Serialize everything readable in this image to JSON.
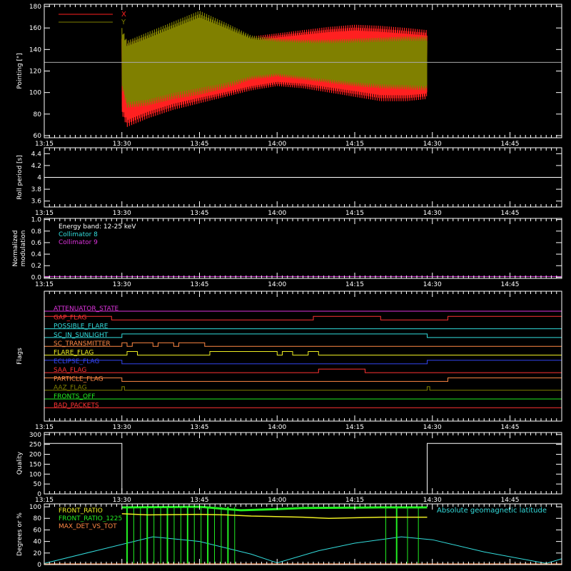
{
  "colors": {
    "bg": "#000000",
    "axis": "#ffffff",
    "x_series": "#ff2020",
    "y_series": "#808000",
    "cyan": "#33dddd",
    "magenta": "#dd33dd",
    "green": "#22ee22",
    "yellow": "#eeee22",
    "orange": "#ff8844"
  },
  "chart_data": [
    {
      "type": "area",
      "name": "pointing",
      "ylabel": "Pointing [\"]",
      "xlim": [
        "13:15",
        "14:55"
      ],
      "ylim": [
        58,
        182
      ],
      "yticks": [
        60,
        80,
        100,
        120,
        140,
        160,
        180
      ],
      "xticklabels": [
        "13:15",
        "13:30",
        "13:45",
        "14:00",
        "14:15",
        "14:30",
        "14:45"
      ],
      "reference_line": 128,
      "legend": [
        "X",
        "Y"
      ],
      "series": [
        {
          "name": "X",
          "x": [
            "13:30",
            "13:31",
            "13:35",
            "13:40",
            "13:45",
            "13:50",
            "13:55",
            "14:00",
            "14:05",
            "14:10",
            "14:15",
            "14:20",
            "14:25",
            "14:29"
          ],
          "upper": [
            150,
            148,
            152,
            155,
            154,
            151,
            152,
            155,
            158,
            161,
            163,
            162,
            160,
            158
          ],
          "lower": [
            80,
            68,
            76,
            84,
            90,
            96,
            102,
            106,
            104,
            100,
            96,
            92,
            92,
            94
          ]
        },
        {
          "name": "Y",
          "x": [
            "13:30",
            "13:31",
            "13:35",
            "13:40",
            "13:45",
            "13:50",
            "13:55",
            "14:00",
            "14:05",
            "14:10",
            "14:15",
            "14:20",
            "14:25",
            "14:29"
          ],
          "upper": [
            160,
            148,
            156,
            166,
            176,
            165,
            153,
            150,
            149,
            149,
            150,
            151,
            152,
            152
          ],
          "lower": [
            105,
            86,
            88,
            94,
            98,
            104,
            112,
            115,
            112,
            109,
            106,
            104,
            103,
            102
          ]
        }
      ]
    },
    {
      "type": "line",
      "name": "roll-period",
      "ylabel": "Roll period [s]",
      "xlim": [
        "13:15",
        "14:55"
      ],
      "ylim": [
        3.5,
        4.5
      ],
      "yticks": [
        3.6,
        3.8,
        4.0,
        4.2,
        4.4
      ],
      "xticklabels": [
        "13:15",
        "13:30",
        "13:45",
        "14:00",
        "14:15",
        "14:30",
        "14:45"
      ],
      "series": [
        {
          "x": [
            "13:15",
            "14:55"
          ],
          "y": [
            4.0,
            4.0
          ]
        }
      ]
    },
    {
      "type": "line",
      "name": "modulation",
      "ylabel": [
        "Normalized",
        "modulation"
      ],
      "xlim": [
        "13:15",
        "14:55"
      ],
      "ylim": [
        -0.02,
        1.02
      ],
      "yticks": [
        0.0,
        0.2,
        0.4,
        0.6,
        0.8,
        1.0
      ],
      "ytick_labels": [
        "0.0",
        "0.2",
        "0.4",
        "0.6",
        "0.8",
        "1.0"
      ],
      "xticklabels": [
        "13:15",
        "13:30",
        "13:45",
        "14:00",
        "14:15",
        "14:30",
        "14:45"
      ],
      "annotations": [
        "Energy band: 12-25 keV",
        "Collimator 8",
        "Collimator 9"
      ],
      "series": [
        {
          "x": [
            "13:15",
            "14:55"
          ],
          "y": [
            0.0,
            0.0
          ]
        }
      ]
    },
    {
      "type": "line",
      "name": "flags",
      "ylabel": "Flags",
      "xlim": [
        "13:15",
        "14:55"
      ],
      "xticklabels": [
        "13:15",
        "13:30",
        "13:45",
        "14:00",
        "14:15",
        "14:30",
        "14:45"
      ],
      "flags": [
        {
          "label": "ATTENUATOR_STATE",
          "color": "#dd33dd",
          "segments": []
        },
        {
          "label": "GAP_FLAG",
          "color": "#ff3333",
          "segments": [
            [
              "13:15",
              "13:28"
            ],
            [
              "14:07",
              "14:20"
            ],
            [
              "14:33",
              "14:55"
            ]
          ]
        },
        {
          "label": "POSSIBLE_FLARE",
          "color": "#33dddd",
          "segments": []
        },
        {
          "label": "SC_IN_SUNLIGHT",
          "color": "#33dddd",
          "segments": [
            [
              "13:30",
              "14:29"
            ]
          ]
        },
        {
          "label": "SC_TRANSMITTER",
          "color": "#ff8844",
          "segments": [
            [
              "13:30",
              "13:31"
            ],
            [
              "13:32",
              "13:36"
            ],
            [
              "13:37",
              "13:40"
            ],
            [
              "13:41",
              "13:46"
            ]
          ]
        },
        {
          "label": "FLARE_FLAG",
          "color": "#eeee22",
          "segments": [
            [
              "13:31",
              "13:33"
            ],
            [
              "13:47",
              "14:00"
            ],
            [
              "14:01",
              "14:03"
            ],
            [
              "14:06",
              "14:08"
            ]
          ]
        },
        {
          "label": "ECLIPSE_FLAG",
          "color": "#3344ee",
          "segments": [
            [
              "13:15",
              "13:30"
            ],
            [
              "14:29",
              "14:55"
            ]
          ]
        },
        {
          "label": "SAA_FLAG",
          "color": "#ff3333",
          "segments": [
            [
              "14:08",
              "14:17"
            ]
          ]
        },
        {
          "label": "PARTICLE_FLAG",
          "color": "#ff8844",
          "segments": [
            [
              "13:15",
              "13:30"
            ],
            [
              "14:33",
              "14:55"
            ]
          ]
        },
        {
          "label": "AAZ_FLAG",
          "color": "#808000",
          "segments": [
            [
              "13:30",
              "13:30.5"
            ],
            [
              "14:29",
              "14:29.5"
            ]
          ]
        },
        {
          "label": "FRONTS_OFF",
          "color": "#22ee22",
          "segments": []
        },
        {
          "label": "BAD_PACKETS",
          "color": "#ff3333",
          "segments": []
        }
      ]
    },
    {
      "type": "line",
      "name": "quality",
      "ylabel": "Quality",
      "xlim": [
        "13:15",
        "14:55"
      ],
      "ylim": [
        0,
        310
      ],
      "yticks": [
        0,
        50,
        100,
        150,
        200,
        250,
        300
      ],
      "xticklabels": [
        "13:15",
        "13:30",
        "13:45",
        "14:00",
        "14:15",
        "14:30",
        "14:45"
      ],
      "series": [
        {
          "x": [
            "13:15",
            "13:30",
            "13:30",
            "14:29",
            "14:29",
            "14:55"
          ],
          "y": [
            255,
            255,
            0,
            0,
            255,
            255
          ]
        }
      ]
    },
    {
      "type": "line",
      "name": "ratios",
      "ylabel": "Degrees or %",
      "xlim": [
        "13:15",
        "14:55"
      ],
      "ylim": [
        0,
        105
      ],
      "yticks": [
        0,
        20,
        40,
        60,
        80,
        100
      ],
      "legend": [
        "FRONT_RATIO",
        "FRONT_RATIO_1225",
        "MAX_DET_VS_TOT"
      ],
      "annotations": [
        "Absolute geomagnetic latitude"
      ],
      "series": [
        {
          "name": "Absolute geomagnetic latitude",
          "x": [
            "13:15",
            "13:25",
            "13:36",
            "13:45",
            "13:55",
            "14:00",
            "14:08",
            "14:15",
            "14:24",
            "14:30",
            "14:40",
            "14:52",
            "14:55"
          ],
          "y": [
            2,
            24,
            48,
            40,
            18,
            3,
            24,
            37,
            48,
            43,
            22,
            2,
            10
          ]
        },
        {
          "name": "FRONT_RATIO",
          "x": [
            "13:30",
            "13:35",
            "13:45",
            "13:50",
            "13:55",
            "14:05",
            "14:10",
            "14:20",
            "14:29"
          ],
          "y": [
            88,
            86,
            87,
            86,
            84,
            82,
            80,
            82,
            82
          ]
        },
        {
          "name": "FRONT_RATIO_1225",
          "x": [
            "13:30",
            "13:45",
            "13:53",
            "14:00",
            "14:05",
            "14:20",
            "14:29"
          ],
          "y": [
            99,
            100,
            94,
            96,
            98,
            99,
            99
          ]
        }
      ]
    }
  ]
}
